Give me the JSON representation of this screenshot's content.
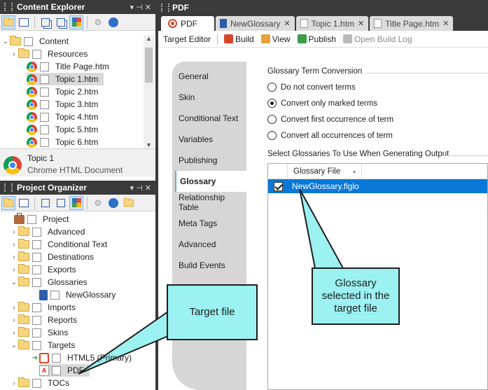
{
  "content_explorer": {
    "title": "Content Explorer",
    "controls": "▾ ⊣ ✕",
    "tree": [
      {
        "label": "Content",
        "type": "folder",
        "arrow": "⌄",
        "indent": 2
      },
      {
        "label": "Resources",
        "type": "folder",
        "arrow": "›",
        "indent": 14
      },
      {
        "label": "Title Page.htm",
        "type": "chrome",
        "arrow": "",
        "indent": 26
      },
      {
        "label": "Topic 1.htm",
        "type": "chrome",
        "arrow": "",
        "indent": 26,
        "selected": true
      },
      {
        "label": "Topic 2.htm",
        "type": "chrome",
        "arrow": "",
        "indent": 26
      },
      {
        "label": "Topic 3.htm",
        "type": "chrome",
        "arrow": "",
        "indent": 26
      },
      {
        "label": "Topic 4.htm",
        "type": "chrome",
        "arrow": "",
        "indent": 26
      },
      {
        "label": "Topic 5.htm",
        "type": "chrome",
        "arrow": "",
        "indent": 26
      },
      {
        "label": "Topic 6.htm",
        "type": "chrome",
        "arrow": "",
        "indent": 26
      }
    ],
    "info": {
      "name": "Topic 1",
      "type": "Chrome HTML Document"
    }
  },
  "project_organizer": {
    "title": "Project Organizer",
    "controls": "▾ ⊣ ✕",
    "tree": [
      {
        "label": "Project",
        "type": "bag",
        "arrow": "",
        "indent": 8
      },
      {
        "label": "Advanced",
        "type": "folder",
        "arrow": "›",
        "indent": 14
      },
      {
        "label": "Conditional Text",
        "type": "folder",
        "arrow": "›",
        "indent": 14
      },
      {
        "label": "Destinations",
        "type": "folder",
        "arrow": "›",
        "indent": 14
      },
      {
        "label": "Exports",
        "type": "folder",
        "arrow": "›",
        "indent": 14
      },
      {
        "label": "Glossaries",
        "type": "folder",
        "arrow": "⌄",
        "indent": 14
      },
      {
        "label": "NewGlossary",
        "type": "glos",
        "arrow": "",
        "indent": 44
      },
      {
        "label": "Imports",
        "type": "folder",
        "arrow": "›",
        "indent": 14
      },
      {
        "label": "Reports",
        "type": "folder",
        "arrow": "›",
        "indent": 14
      },
      {
        "label": "Skins",
        "type": "folder",
        "arrow": "›",
        "indent": 14
      },
      {
        "label": "Targets",
        "type": "folder",
        "arrow": "⌄",
        "indent": 14
      },
      {
        "label": "HTML5 (Primary)",
        "type": "targ",
        "arrow": "➜",
        "indent": 44
      },
      {
        "label": "PDF",
        "type": "pdf",
        "arrow": "",
        "indent": 44,
        "selected": true
      },
      {
        "label": "TOCs",
        "type": "folder",
        "arrow": "›",
        "indent": 14
      }
    ]
  },
  "main": {
    "title": "PDF",
    "tabs": [
      {
        "label": "PDF",
        "icon": "target",
        "active": true
      },
      {
        "label": "NewGlossary",
        "icon": "glos",
        "active": false
      },
      {
        "label": "Topic 1.htm",
        "icon": "page",
        "active": false
      },
      {
        "label": "Title Page.htm",
        "icon": "page",
        "active": false
      }
    ],
    "toolbar": {
      "editor_label": "Target Editor",
      "build": "Build",
      "view": "View",
      "publish": "Publish",
      "build_log": "Open Build Log"
    },
    "vtabs": [
      "General",
      "Skin",
      "Conditional Text",
      "Variables",
      "Publishing",
      "Glossary",
      "Relationship Table",
      "Meta Tags",
      "Advanced",
      "Build Events"
    ],
    "active_vtab": "Glossary",
    "term_conversion": {
      "title": "Glossary Term Conversion",
      "options": [
        "Do not convert terms",
        "Convert only marked terms",
        "Convert first occurrence of term",
        "Convert all occurrences of term"
      ],
      "selected_index": 1
    },
    "glossaries": {
      "title": "Select Glossaries To Use When Generating Output",
      "column": "Glossary File",
      "sort_icon": "▲",
      "rows": [
        {
          "file": "NewGlossary.flglo",
          "checked": true
        }
      ]
    }
  },
  "callouts": {
    "target_file": "Target file",
    "glossary_selected": "Glossary selected in the target file"
  },
  "colors": {
    "titlebar": "#3a3a3a",
    "selection": "#0a78d7",
    "callout": "#9cf1f1"
  }
}
